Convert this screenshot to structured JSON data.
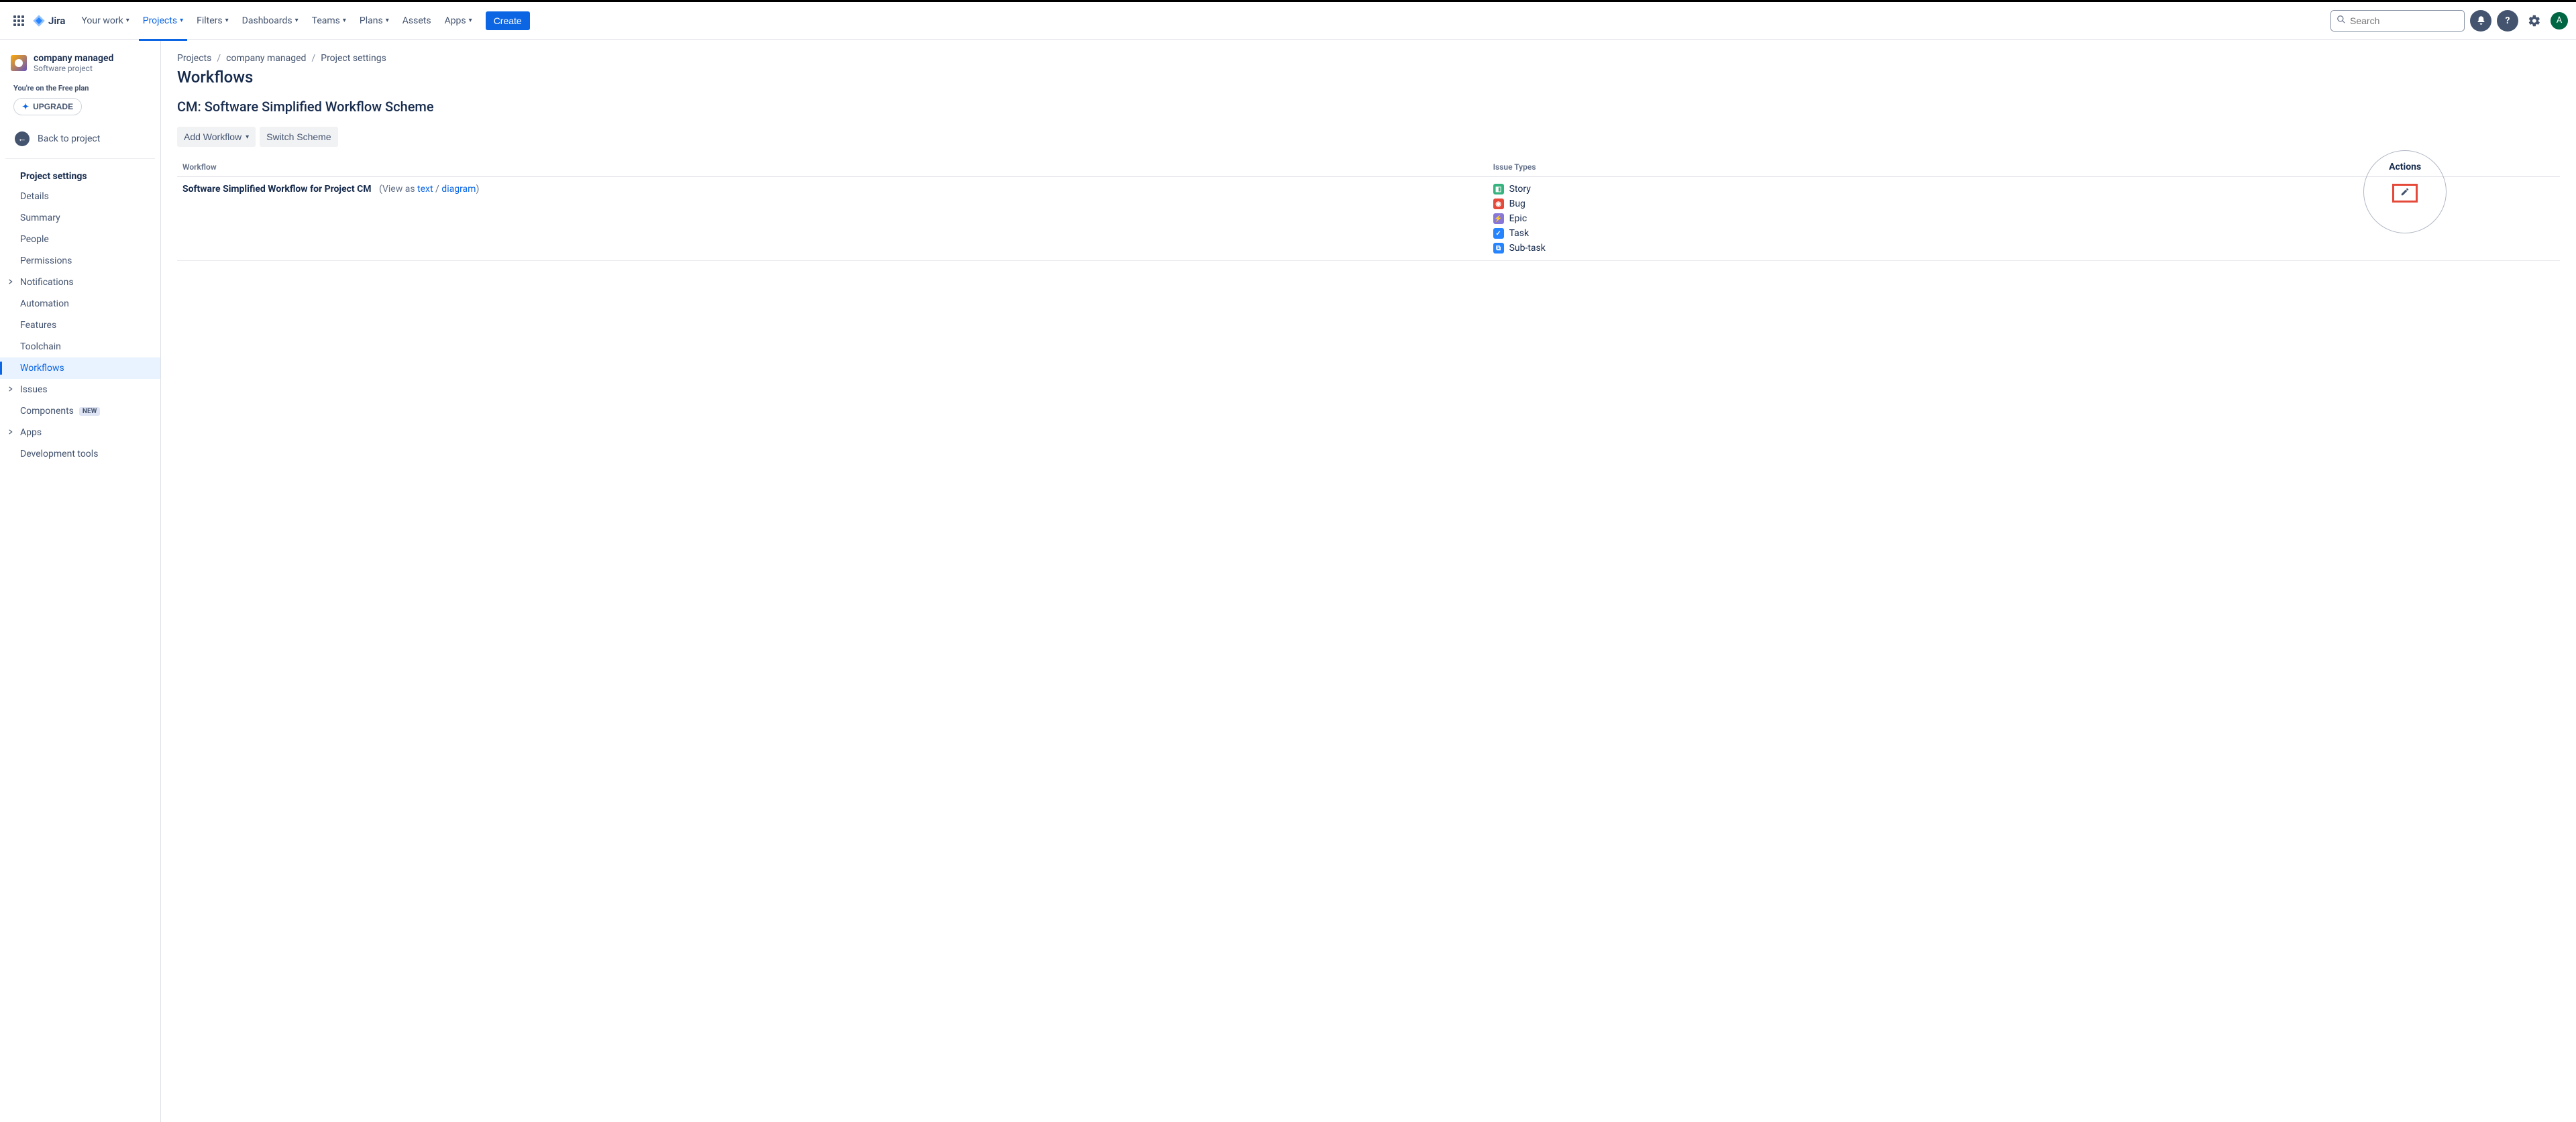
{
  "brand": "Jira",
  "nav": {
    "items": [
      {
        "label": "Your work",
        "hasMenu": true,
        "active": false
      },
      {
        "label": "Projects",
        "hasMenu": true,
        "active": true
      },
      {
        "label": "Filters",
        "hasMenu": true,
        "active": false
      },
      {
        "label": "Dashboards",
        "hasMenu": true,
        "active": false
      },
      {
        "label": "Teams",
        "hasMenu": true,
        "active": false
      },
      {
        "label": "Plans",
        "hasMenu": true,
        "active": false
      },
      {
        "label": "Assets",
        "hasMenu": false,
        "active": false
      },
      {
        "label": "Apps",
        "hasMenu": true,
        "active": false
      }
    ],
    "create": "Create",
    "searchPlaceholder": "Search",
    "avatarInitial": "A"
  },
  "sidebar": {
    "projectName": "company managed",
    "projectType": "Software project",
    "freePlan": "You're on the Free plan",
    "upgrade": "UPGRADE",
    "back": "Back to project",
    "sectionTitle": "Project settings",
    "items": [
      {
        "label": "Details",
        "expandable": false,
        "active": false
      },
      {
        "label": "Summary",
        "expandable": false,
        "active": false
      },
      {
        "label": "People",
        "expandable": false,
        "active": false
      },
      {
        "label": "Permissions",
        "expandable": false,
        "active": false
      },
      {
        "label": "Notifications",
        "expandable": true,
        "active": false
      },
      {
        "label": "Automation",
        "expandable": false,
        "active": false
      },
      {
        "label": "Features",
        "expandable": false,
        "active": false
      },
      {
        "label": "Toolchain",
        "expandable": false,
        "active": false
      },
      {
        "label": "Workflows",
        "expandable": false,
        "active": true
      },
      {
        "label": "Issues",
        "expandable": true,
        "active": false
      },
      {
        "label": "Components",
        "expandable": false,
        "active": false,
        "badge": "NEW"
      },
      {
        "label": "Apps",
        "expandable": true,
        "active": false
      },
      {
        "label": "Development tools",
        "expandable": false,
        "active": false
      }
    ]
  },
  "main": {
    "breadcrumbs": [
      "Projects",
      "company managed",
      "Project settings"
    ],
    "title": "Workflows",
    "schemeTitle": "CM: Software Simplified Workflow Scheme",
    "addWorkflow": "Add Workflow",
    "switchScheme": "Switch Scheme",
    "table": {
      "columns": {
        "workflow": "Workflow",
        "issueTypes": "Issue Types",
        "actions": "Actions"
      },
      "row": {
        "name": "Software Simplified Workflow for Project CM",
        "viewAsPrefix": "(View as ",
        "viewAsText": "text",
        "viewAsSep": " / ",
        "viewAsDiagram": "diagram",
        "viewAsSuffix": ")",
        "issueTypes": [
          {
            "icon": "story-icon",
            "cls": "ic-story",
            "glyph": "◧",
            "label": "Story"
          },
          {
            "icon": "bug-icon",
            "cls": "ic-bug",
            "glyph": "◉",
            "label": "Bug"
          },
          {
            "icon": "epic-icon",
            "cls": "ic-epic",
            "glyph": "⚡",
            "label": "Epic"
          },
          {
            "icon": "task-icon",
            "cls": "ic-task",
            "glyph": "✓",
            "label": "Task"
          },
          {
            "icon": "subtask-icon",
            "cls": "ic-sub",
            "glyph": "⧉",
            "label": "Sub-task"
          }
        ]
      }
    }
  }
}
